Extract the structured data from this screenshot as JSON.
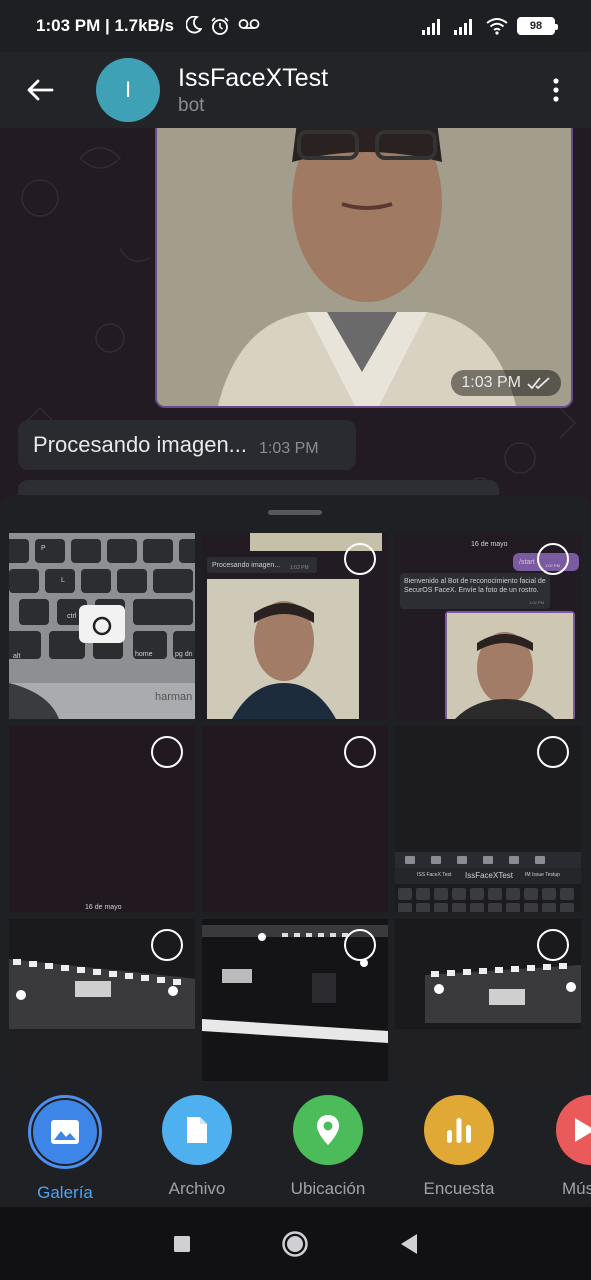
{
  "status_bar": {
    "time_speed": "1:03 PM | 1.7kB/s",
    "battery": "98"
  },
  "header": {
    "avatar_letter": "I",
    "title": "IssFaceXTest",
    "subtitle": "bot"
  },
  "chat": {
    "photo_time": "1:03 PM",
    "message_text": "Procesando imagen...",
    "message_time": "1:03 PM"
  },
  "gallery": {
    "thumb_processing": "Procesando imagen...",
    "thumb_processing_time": "1:03 PM",
    "thumb_date": "16 de mayo",
    "thumb_start": "/start",
    "thumb_start_time": "1:02 PM",
    "thumb_welcome": "Bienvenido al Bot de reconocimiento facial de SecurOS FaceX. Envíe la foto de un rostro.",
    "thumb_welcome_time": "1:02 PM",
    "thumb_date_2": "16 de mayo",
    "thumb_kb_title": "IssFaceXTest",
    "thumb_kb_left": "ISS FaceX Test",
    "thumb_kb_right": "IM Issue Testup",
    "thumb_keyboard_brand": "harman",
    "thumb_keys": [
      "P",
      "L",
      "ctrl",
      "alt",
      "home",
      "pg dn"
    ]
  },
  "attach_bar": {
    "items": [
      {
        "label": "Galería",
        "color": "#3d86e8",
        "icon": "gallery-icon"
      },
      {
        "label": "Archivo",
        "color": "#4fb0ef",
        "icon": "file-icon"
      },
      {
        "label": "Ubicación",
        "color": "#4cbc5a",
        "icon": "location-pin-icon"
      },
      {
        "label": "Encuesta",
        "color": "#e0a834",
        "icon": "poll-icon"
      },
      {
        "label": "Mús",
        "color": "#ea5a5a",
        "icon": "music-icon"
      }
    ]
  }
}
